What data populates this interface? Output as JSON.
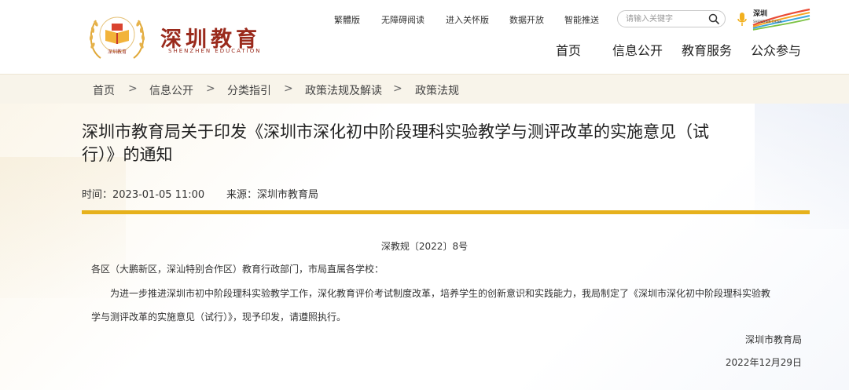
{
  "header": {
    "logo_title": "深圳教育",
    "logo_subtitle": "SHENZHEN EDUCATION",
    "logo_badge_text": "深圳教育",
    "top_links": [
      "繁體版",
      "无障碍阅读",
      "进入关怀版",
      "数据开放",
      "智能推送"
    ],
    "search_placeholder": "请输入关键字",
    "szchina_label": "深圳",
    "szchina_sub": "SHENZHEN CHINA",
    "nav": [
      "首页",
      "信息公开",
      "教育服务",
      "公众参与"
    ]
  },
  "breadcrumb": [
    "首页",
    "信息公开",
    "分类指引",
    "政策法规及解读",
    "政策法规"
  ],
  "breadcrumb_separator": ">",
  "article": {
    "title_line1": "深圳市教育局关于印发《深圳市深化初中阶段理科实验教学与测评改革的实施意见（试",
    "title_line2": "行）》的通知",
    "time": "时间：2023-01-05 11:00",
    "source": "来源：深圳市教育局",
    "doc_number": "深教规〔2022〕8号",
    "salutation": "各区（大鹏新区，深汕特别合作区）教育行政部门，市局直属各学校：",
    "body_line1": "为进一步推进深圳市初中阶段理科实验教学工作，深化教育评价考试制度改革，培养学生的创新意识和实践能力，我局制定了《深圳市深化初中阶段理科实验教",
    "body_line2": "学与测评改革的实施意见（试行）》，现予印发，请遵照执行。",
    "signature": "深圳市教育局",
    "date": "2022年12月29日"
  },
  "colors": {
    "logo_red": "#9a2a1c",
    "gold_bar": "#e6b11c",
    "crumb_band": "#f8f4ea"
  }
}
